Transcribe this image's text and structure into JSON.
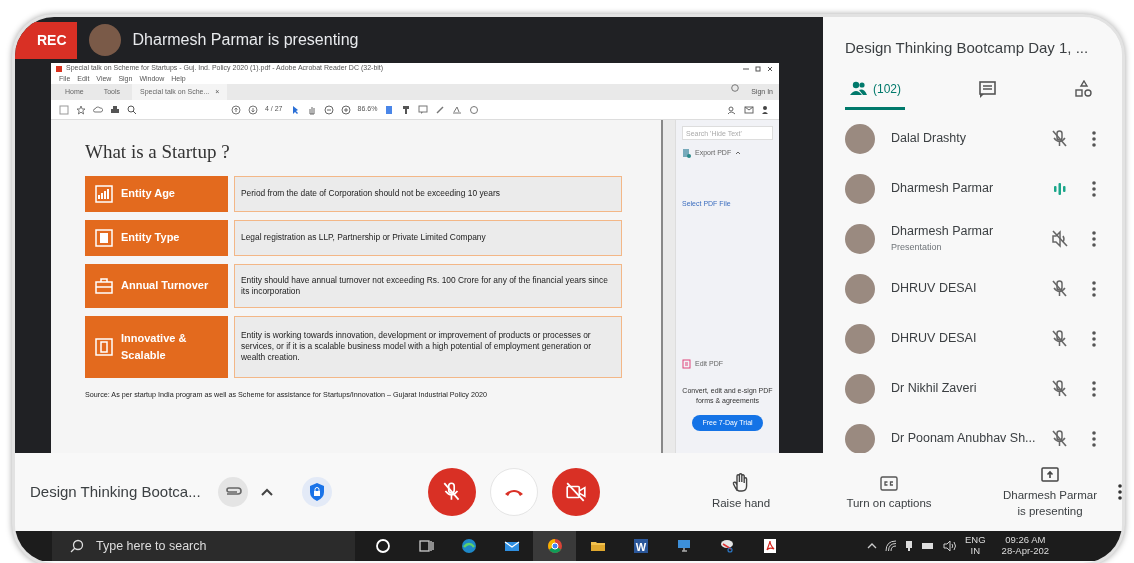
{
  "stage": {
    "rec": "REC",
    "presenter_title": "Dharmesh Parmar is presenting"
  },
  "acrobat": {
    "title": "Special talk on Scheme for Startups - Guj. Ind. Policy 2020 (1).pdf - Adobe Acrobat Reader DC (32-bit)",
    "menu": [
      "File",
      "Edit",
      "View",
      "Sign",
      "Window",
      "Help"
    ],
    "tabs": [
      {
        "label": "Home",
        "selected": false
      },
      {
        "label": "Tools",
        "selected": false
      },
      {
        "label": "Special talk on Sche...",
        "selected": true
      }
    ],
    "tab_close": "×",
    "page": "4 / 27",
    "zoom": "86.6%",
    "sign_in": "Sign In",
    "pane": {
      "search_placeholder": "Search 'Hide Text'",
      "export": "Export PDF",
      "select_file": "Select PDF File",
      "edit": "Edit PDF",
      "promo": "Convert, edit and e-sign PDF forms & agreements",
      "trial": "Free 7-Day Trial"
    }
  },
  "slide": {
    "title": "What is a Startup ?",
    "rows": [
      {
        "label": "Entity Age",
        "text": "Period from the date of Corporation should not be exceeding 10 years"
      },
      {
        "label": "Entity Type",
        "text": "Legal registration as LLP, Partnership or Private Limited Company"
      },
      {
        "label": "Annual Turnover",
        "text": "Entity should have annual turnover not exceeding Rs. 100 Crore for any of the financial years since its incorporation"
      },
      {
        "label": "Innovative & Scalable",
        "text": "Entity is working towards innovation, development or improvement of products or processes or services, or if it is a scalable business model with a high potential of employment generation or wealth creation."
      }
    ],
    "source": "Source: As per startup India program as well as Scheme for assistance for Startups/Innovation – Gujarat Industrial Policy 2020"
  },
  "panel": {
    "title": "Design Thinking Bootcamp Day 1, ...",
    "tabs": [
      {
        "kind": "people",
        "label": "(102)",
        "selected": true
      },
      {
        "kind": "chat",
        "selected": false
      },
      {
        "kind": "activities",
        "selected": false
      }
    ],
    "participants": [
      {
        "name": "Dalal Drashty",
        "kind": "muted"
      },
      {
        "name": "Dharmesh Parmar",
        "kind": "speaking"
      },
      {
        "name": "Dharmesh Parmar",
        "subtitle": "Presentation",
        "kind": "presentation"
      },
      {
        "name": "DHRUV DESAI",
        "kind": "muted"
      },
      {
        "name": "DHRUV DESAI",
        "kind": "muted"
      },
      {
        "name": "Dr Nikhil Zaveri",
        "kind": "muted"
      },
      {
        "name": "Dr Poonam Anubhav Sh...",
        "kind": "muted"
      }
    ]
  },
  "controls": {
    "meeting_title": "Design Thinking Bootca...",
    "mic_on": false,
    "camera_on": false,
    "actions": [
      {
        "kind": "hand",
        "label": "Raise hand"
      },
      {
        "kind": "captions",
        "label": "Turn on captions"
      },
      {
        "kind": "present",
        "label": "Dharmesh Parmar is presenting"
      }
    ]
  },
  "taskbar": {
    "search_placeholder": "Type here to search",
    "apps": [
      {
        "kind": "cortana",
        "selected": false
      },
      {
        "kind": "taskview",
        "selected": false
      },
      {
        "kind": "edge",
        "selected": false
      },
      {
        "kind": "mail",
        "selected": false
      },
      {
        "kind": "chrome",
        "selected": true
      },
      {
        "kind": "folder",
        "selected": false
      },
      {
        "kind": "word",
        "glyph": "W",
        "selected": false
      },
      {
        "kind": "computer",
        "selected": false
      },
      {
        "kind": "tool",
        "selected": false
      },
      {
        "kind": "acrobat",
        "selected": false
      }
    ],
    "lang": "ENG",
    "region": "IN",
    "time": "09:26 AM",
    "date": "28-Apr-202"
  }
}
